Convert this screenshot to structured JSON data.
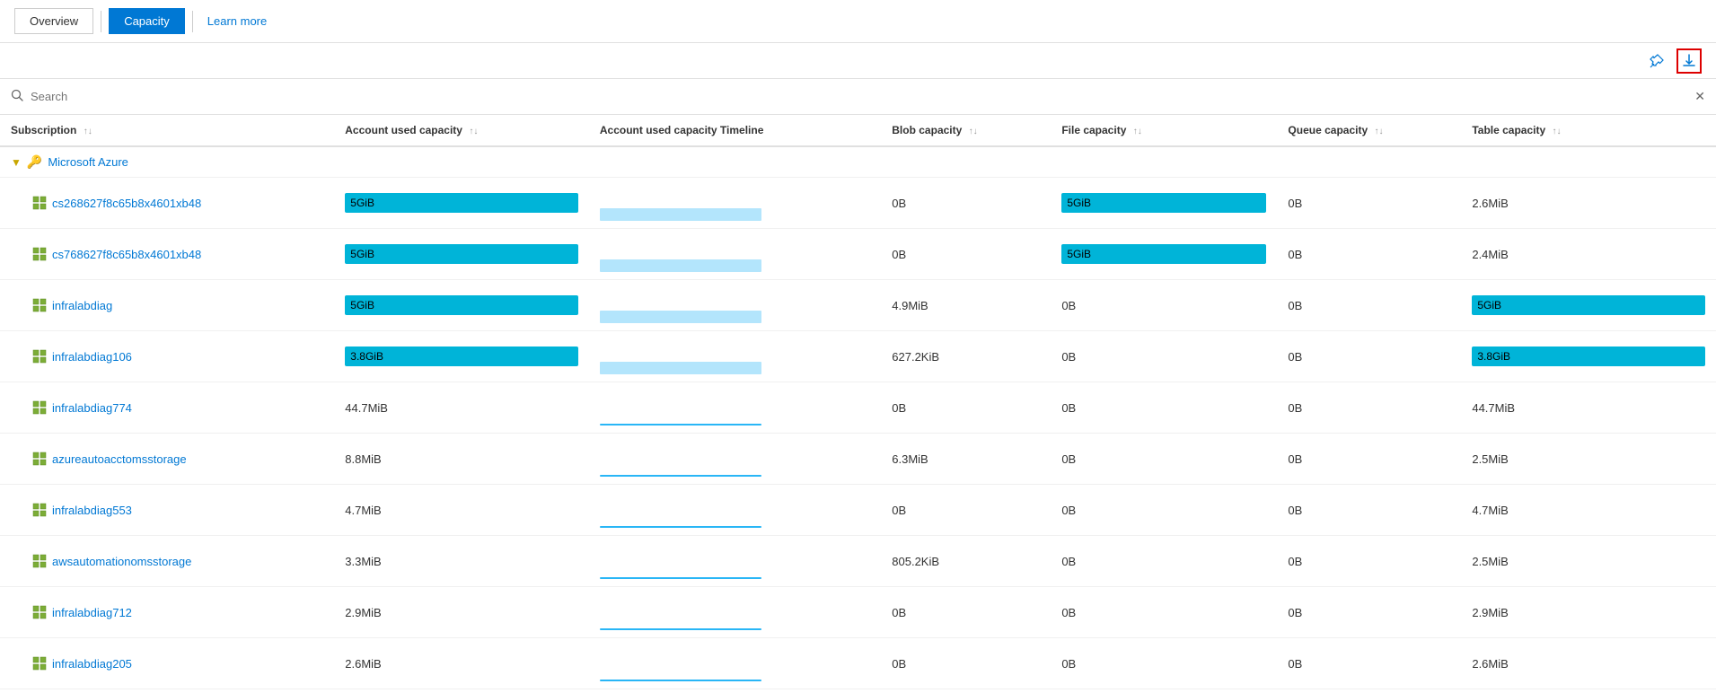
{
  "nav": {
    "overview_label": "Overview",
    "capacity_label": "Capacity",
    "learn_more_label": "Learn more"
  },
  "toolbar": {
    "pin_icon": "📌",
    "download_icon": "⬇"
  },
  "search": {
    "placeholder": "Search",
    "clear_icon": "✕"
  },
  "table": {
    "columns": {
      "subscription": "Subscription",
      "account_used_capacity": "Account used capacity",
      "account_used_capacity_timeline": "Account used capacity Timeline",
      "blob_capacity": "Blob capacity",
      "file_capacity": "File capacity",
      "queue_capacity": "Queue capacity",
      "table_capacity": "Table capacity"
    },
    "group": {
      "label": "Microsoft Azure",
      "icon": "🔑"
    },
    "rows": [
      {
        "name": "cs268627f8c65b8x4601xb48",
        "account_used_capacity": "5GiB",
        "account_used_capacity_type": "bar_cyan",
        "account_used_timeline_type": "bar_light",
        "blob_capacity": "0B",
        "file_capacity": "5GiB",
        "file_capacity_type": "bar_cyan",
        "queue_capacity": "0B",
        "table_capacity": "2.6MiB",
        "table_capacity_type": "text"
      },
      {
        "name": "cs768627f8c65b8x4601xb48",
        "account_used_capacity": "5GiB",
        "account_used_capacity_type": "bar_cyan",
        "account_used_timeline_type": "bar_light",
        "blob_capacity": "0B",
        "file_capacity": "5GiB",
        "file_capacity_type": "bar_cyan",
        "queue_capacity": "0B",
        "table_capacity": "2.4MiB",
        "table_capacity_type": "text"
      },
      {
        "name": "infralabdiag",
        "account_used_capacity": "5GiB",
        "account_used_capacity_type": "bar_cyan",
        "account_used_timeline_type": "bar_light",
        "blob_capacity": "4.9MiB",
        "file_capacity": "0B",
        "file_capacity_type": "text",
        "queue_capacity": "0B",
        "table_capacity": "5GiB",
        "table_capacity_type": "bar_cyan"
      },
      {
        "name": "infralabdiag106",
        "account_used_capacity": "3.8GiB",
        "account_used_capacity_type": "bar_cyan",
        "account_used_timeline_type": "bar_light",
        "blob_capacity": "627.2KiB",
        "file_capacity": "0B",
        "file_capacity_type": "text",
        "queue_capacity": "0B",
        "table_capacity": "3.8GiB",
        "table_capacity_type": "bar_cyan"
      },
      {
        "name": "infralabdiag774",
        "account_used_capacity": "44.7MiB",
        "account_used_capacity_type": "text",
        "account_used_timeline_type": "bar_line",
        "blob_capacity": "0B",
        "file_capacity": "0B",
        "file_capacity_type": "text",
        "queue_capacity": "0B",
        "table_capacity": "44.7MiB",
        "table_capacity_type": "text"
      },
      {
        "name": "azureautoacctomsstorage",
        "account_used_capacity": "8.8MiB",
        "account_used_capacity_type": "text",
        "account_used_timeline_type": "bar_line",
        "blob_capacity": "6.3MiB",
        "file_capacity": "0B",
        "file_capacity_type": "text",
        "queue_capacity": "0B",
        "table_capacity": "2.5MiB",
        "table_capacity_type": "text"
      },
      {
        "name": "infralabdiag553",
        "account_used_capacity": "4.7MiB",
        "account_used_capacity_type": "text",
        "account_used_timeline_type": "bar_line",
        "blob_capacity": "0B",
        "file_capacity": "0B",
        "file_capacity_type": "text",
        "queue_capacity": "0B",
        "table_capacity": "4.7MiB",
        "table_capacity_type": "text"
      },
      {
        "name": "awsautomationomsstorage",
        "account_used_capacity": "3.3MiB",
        "account_used_capacity_type": "text",
        "account_used_timeline_type": "bar_line",
        "blob_capacity": "805.2KiB",
        "file_capacity": "0B",
        "file_capacity_type": "text",
        "queue_capacity": "0B",
        "table_capacity": "2.5MiB",
        "table_capacity_type": "text"
      },
      {
        "name": "infralabdiag712",
        "account_used_capacity": "2.9MiB",
        "account_used_capacity_type": "text",
        "account_used_timeline_type": "bar_line",
        "blob_capacity": "0B",
        "file_capacity": "0B",
        "file_capacity_type": "text",
        "queue_capacity": "0B",
        "table_capacity": "2.9MiB",
        "table_capacity_type": "text"
      },
      {
        "name": "infralabdiag205",
        "account_used_capacity": "2.6MiB",
        "account_used_capacity_type": "text",
        "account_used_timeline_type": "bar_line",
        "blob_capacity": "0B",
        "file_capacity": "0B",
        "file_capacity_type": "text",
        "queue_capacity": "0B",
        "table_capacity": "2.6MiB",
        "table_capacity_type": "text"
      }
    ]
  }
}
